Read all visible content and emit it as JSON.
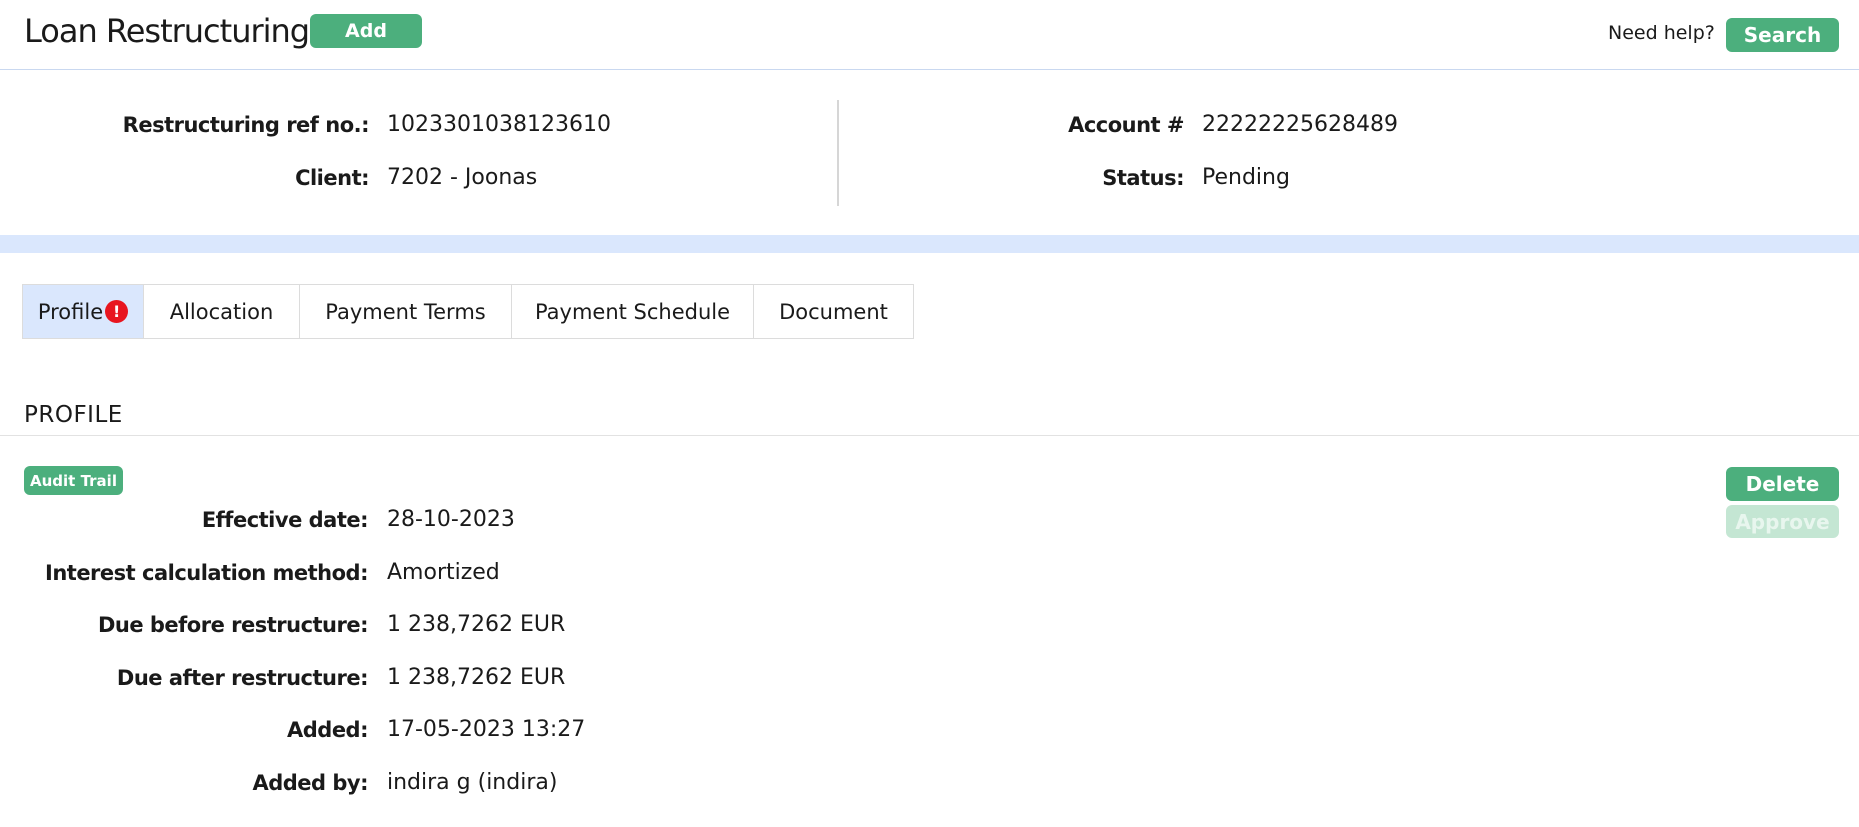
{
  "header": {
    "title": "Loan Restructuring",
    "add_label": "Add",
    "help_text": "Need help?",
    "search_label": "Search"
  },
  "summary": {
    "ref_label": "Restructuring ref no.:",
    "ref_value": "1023301038123610",
    "client_label": "Client:",
    "client_value": "7202 - Joonas",
    "account_label": "Account #",
    "account_value": "22222225628489",
    "status_label": "Status:",
    "status_value": "Pending"
  },
  "tabs": [
    {
      "label": "Profile",
      "active": true,
      "warning": "!"
    },
    {
      "label": "Allocation"
    },
    {
      "label": "Payment Terms"
    },
    {
      "label": "Payment Schedule"
    },
    {
      "label": "Document"
    }
  ],
  "profile": {
    "section_title": "PROFILE",
    "audit_trail_label": "Audit Trail",
    "delete_label": "Delete",
    "approve_label": "Approve",
    "fields": [
      {
        "label": "Effective date:",
        "value": "28-10-2023"
      },
      {
        "label": "Interest calculation method:",
        "value": "Amortized"
      },
      {
        "label": "Due before restructure:",
        "value": "1 238,7262 EUR"
      },
      {
        "label": "Due after restructure:",
        "value": "1 238,7262 EUR"
      },
      {
        "label": "Added:",
        "value": "17-05-2023 13:27"
      },
      {
        "label": "Added by:",
        "value": "indira g (indira)"
      }
    ]
  },
  "colors": {
    "accent_green": "#4caf7d",
    "approve_disabled": "#c4e6d3",
    "band_blue": "#dae7fd",
    "warning_red": "#e8151f"
  }
}
